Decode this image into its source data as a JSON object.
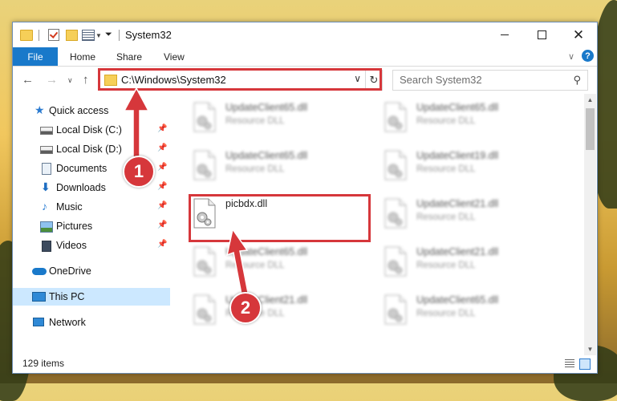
{
  "window": {
    "title": "System32",
    "controls": {
      "minimize": "minimize-icon",
      "maximize": "maximize-icon",
      "close": "close-icon"
    }
  },
  "ribbon": {
    "tabs": [
      "File",
      "Home",
      "Share",
      "View"
    ],
    "help": "?"
  },
  "nav": {
    "address": "C:\\Windows\\System32",
    "search_placeholder": "Search System32"
  },
  "sidebar": {
    "quick_access": "Quick access",
    "items": [
      {
        "label": "Local Disk (C:)",
        "icon": "disk-icon"
      },
      {
        "label": "Local Disk (D:)",
        "icon": "disk-icon"
      },
      {
        "label": "Documents",
        "icon": "documents-icon"
      },
      {
        "label": "Downloads",
        "icon": "downloads-icon"
      },
      {
        "label": "Music",
        "icon": "music-icon"
      },
      {
        "label": "Pictures",
        "icon": "pictures-icon"
      },
      {
        "label": "Videos",
        "icon": "videos-icon"
      }
    ],
    "onedrive": "OneDrive",
    "thispc": "This PC",
    "network": "Network"
  },
  "files": [
    {
      "name": "UpdateClient65.dll",
      "type": "Resource DLL"
    },
    {
      "name": "UpdateClient65.dll",
      "type": "Resource DLL"
    },
    {
      "name": "UpdateClient65.dll",
      "type": "Resource DLL"
    },
    {
      "name": "UpdateClient19.dll",
      "type": "Resource DLL"
    },
    {
      "name": "picbdx.dll",
      "type": ""
    },
    {
      "name": "UpdateClient21.dll",
      "type": "Resource DLL"
    },
    {
      "name": "UpdateClient65.dll",
      "type": "Resource DLL"
    },
    {
      "name": "UpdateClient21.dll",
      "type": "Resource DLL"
    },
    {
      "name": "UpdateClient21.dll",
      "type": "Resource DLL"
    },
    {
      "name": "UpdateClient65.dll",
      "type": "Resource DLL"
    }
  ],
  "status": {
    "items": "129 items"
  },
  "annotations": {
    "step1": "1",
    "step2": "2"
  },
  "colors": {
    "accent": "#1979ca",
    "highlight": "#d6373b",
    "selected": "#cce8ff"
  }
}
